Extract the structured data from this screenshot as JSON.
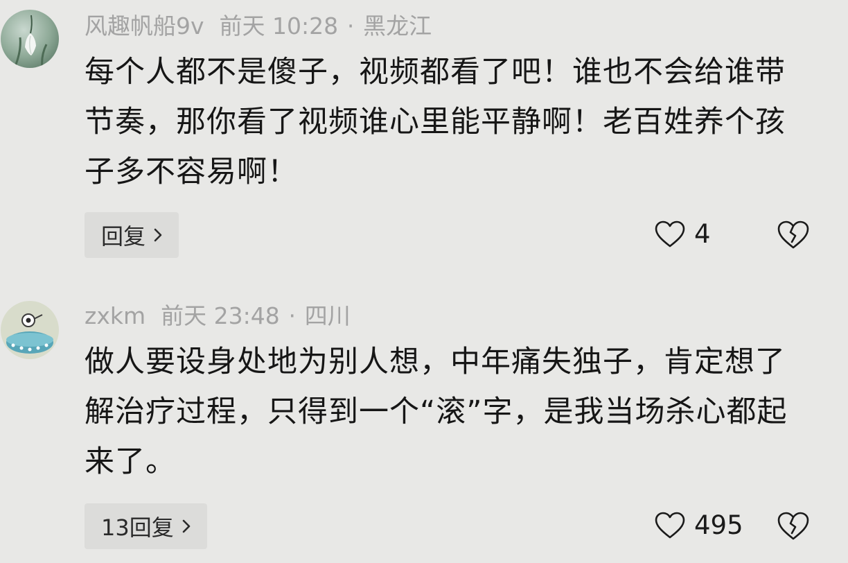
{
  "comments": [
    {
      "username": "风趣帆船9v",
      "time": "前天 10:28",
      "separator": "·",
      "location": "黑龙江",
      "text": "每个人都不是傻子，视频都看了吧！谁也不会给谁带节奏，那你看了视频谁心里能平静啊！老百姓养个孩子多不容易啊！",
      "reply_label": "回复",
      "like_count": "4",
      "avatar": "snowdrop-flower-avatar"
    },
    {
      "username": "zxkm",
      "time": "前天 23:48",
      "separator": "·",
      "location": "四川",
      "text": "做人要设身处地为别人想，中年痛失独子，肯定想了解治疗过程，只得到一个“滚”字，是我当场杀心都起来了。",
      "reply_label": "13回复",
      "like_count": "495",
      "avatar": "cartoon-ufo-avatar"
    }
  ],
  "icons": {
    "like": "heart-outline-icon",
    "dislike": "broken-heart-icon",
    "reply_arrow": "chevron-right-icon"
  },
  "colors": {
    "background": "#e8e8e6",
    "meta_text": "#a3a3a3",
    "body_text": "#161616",
    "reply_bg": "#dcdcda"
  }
}
